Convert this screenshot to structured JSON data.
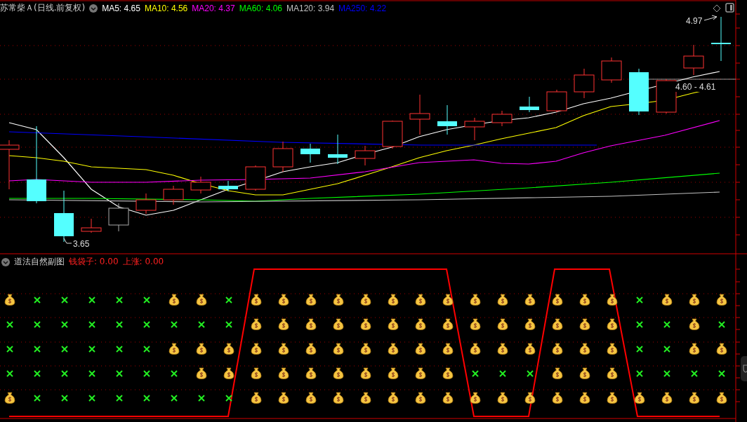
{
  "header": {
    "title": "苏常柴Ａ(日线.前复权)",
    "indicators": [
      {
        "label": "MA5: 4.65",
        "color": "#ffffff"
      },
      {
        "label": "MA10: 4.56",
        "color": "#ffff00"
      },
      {
        "label": "MA20: 4.37",
        "color": "#ff00ff"
      },
      {
        "label": "MA60: 4.06",
        "color": "#00ff00"
      },
      {
        "label": "MA120: 3.94",
        "color": "#c0c0c0"
      },
      {
        "label": "MA250: 4.22",
        "color": "#0000ff"
      }
    ]
  },
  "annotations": {
    "high": "4.97",
    "low": "3.65",
    "range": "4.60 - 4.61"
  },
  "sub_chart": {
    "title": "道法自然副图",
    "values": [
      {
        "label": "钱袋子: 0.00"
      },
      {
        "label": "上涨: 0.00"
      }
    ],
    "rows": [
      {
        "cells": [
          {
            "kind": "bag"
          },
          {
            "kind": "cross"
          },
          {
            "kind": "cross"
          },
          {
            "kind": "cross"
          },
          {
            "kind": "cross"
          },
          {
            "kind": "cross"
          },
          {
            "kind": "bag"
          },
          {
            "kind": "bag"
          },
          {
            "kind": "cross"
          },
          {
            "kind": "bag"
          },
          {
            "kind": "bag"
          },
          {
            "kind": "bag"
          },
          {
            "kind": "bag"
          },
          {
            "kind": "bag"
          },
          {
            "kind": "bag"
          },
          {
            "kind": "bag"
          },
          {
            "kind": "bag"
          },
          {
            "kind": "bag"
          },
          {
            "kind": "bag"
          },
          {
            "kind": "bag"
          },
          {
            "kind": "bag"
          },
          {
            "kind": "bag"
          },
          {
            "kind": "bag"
          },
          {
            "kind": "cross"
          },
          {
            "kind": "bag"
          },
          {
            "kind": "bag"
          },
          {
            "kind": "bag"
          }
        ]
      },
      {
        "cells": [
          {
            "kind": "cross"
          },
          {
            "kind": "cross"
          },
          {
            "kind": "cross"
          },
          {
            "kind": "cross"
          },
          {
            "kind": "cross"
          },
          {
            "kind": "cross"
          },
          {
            "kind": "cross"
          },
          {
            "kind": "cross"
          },
          {
            "kind": "cross"
          },
          {
            "kind": "bag"
          },
          {
            "kind": "bag"
          },
          {
            "kind": "bag"
          },
          {
            "kind": "bag"
          },
          {
            "kind": "bag"
          },
          {
            "kind": "bag"
          },
          {
            "kind": "bag"
          },
          {
            "kind": "bag"
          },
          {
            "kind": "bag"
          },
          {
            "kind": "bag"
          },
          {
            "kind": "bag"
          },
          {
            "kind": "bag"
          },
          {
            "kind": "bag"
          },
          {
            "kind": "bag"
          },
          {
            "kind": "cross"
          },
          {
            "kind": "cross"
          },
          {
            "kind": "bag"
          },
          {
            "kind": "cross"
          }
        ]
      },
      {
        "cells": [
          {
            "kind": "cross"
          },
          {
            "kind": "cross"
          },
          {
            "kind": "cross"
          },
          {
            "kind": "cross"
          },
          {
            "kind": "cross"
          },
          {
            "kind": "cross"
          },
          {
            "kind": "bag"
          },
          {
            "kind": "bag"
          },
          {
            "kind": "bag"
          },
          {
            "kind": "bag"
          },
          {
            "kind": "bag"
          },
          {
            "kind": "bag"
          },
          {
            "kind": "bag"
          },
          {
            "kind": "bag"
          },
          {
            "kind": "bag"
          },
          {
            "kind": "bag"
          },
          {
            "kind": "bag"
          },
          {
            "kind": "bag"
          },
          {
            "kind": "bag"
          },
          {
            "kind": "bag"
          },
          {
            "kind": "bag"
          },
          {
            "kind": "bag"
          },
          {
            "kind": "bag"
          },
          {
            "kind": "cross"
          },
          {
            "kind": "cross"
          },
          {
            "kind": "bag"
          },
          {
            "kind": "bag"
          }
        ]
      },
      {
        "cells": [
          {
            "kind": "cross"
          },
          {
            "kind": "cross"
          },
          {
            "kind": "cross"
          },
          {
            "kind": "cross"
          },
          {
            "kind": "cross"
          },
          {
            "kind": "cross"
          },
          {
            "kind": "cross"
          },
          {
            "kind": "bag"
          },
          {
            "kind": "bag"
          },
          {
            "kind": "bag"
          },
          {
            "kind": "bag"
          },
          {
            "kind": "bag"
          },
          {
            "kind": "bag"
          },
          {
            "kind": "bag"
          },
          {
            "kind": "bag"
          },
          {
            "kind": "bag"
          },
          {
            "kind": "bag"
          },
          {
            "kind": "cross"
          },
          {
            "kind": "cross"
          },
          {
            "kind": "cross"
          },
          {
            "kind": "bag"
          },
          {
            "kind": "bag"
          },
          {
            "kind": "bag"
          },
          {
            "kind": "cross"
          },
          {
            "kind": "cross"
          },
          {
            "kind": "cross"
          },
          {
            "kind": "cross"
          }
        ]
      },
      {
        "cells": [
          {
            "kind": "bag"
          },
          {
            "kind": "cross"
          },
          {
            "kind": "cross"
          },
          {
            "kind": "cross"
          },
          {
            "kind": "cross"
          },
          {
            "kind": "cross"
          },
          {
            "kind": "cross"
          },
          {
            "kind": "cross"
          },
          {
            "kind": "cross"
          },
          {
            "kind": "bag"
          },
          {
            "kind": "bag"
          },
          {
            "kind": "bag"
          },
          {
            "kind": "bag"
          },
          {
            "kind": "bag"
          },
          {
            "kind": "bag"
          },
          {
            "kind": "bag"
          },
          {
            "kind": "bag"
          },
          {
            "kind": "bag"
          },
          {
            "kind": "bag"
          },
          {
            "kind": "bag"
          },
          {
            "kind": "bag"
          },
          {
            "kind": "bag"
          },
          {
            "kind": "bag"
          },
          {
            "kind": "bag"
          },
          {
            "kind": "bag"
          },
          {
            "kind": "bag"
          },
          {
            "kind": "bag"
          }
        ]
      }
    ]
  }
}
